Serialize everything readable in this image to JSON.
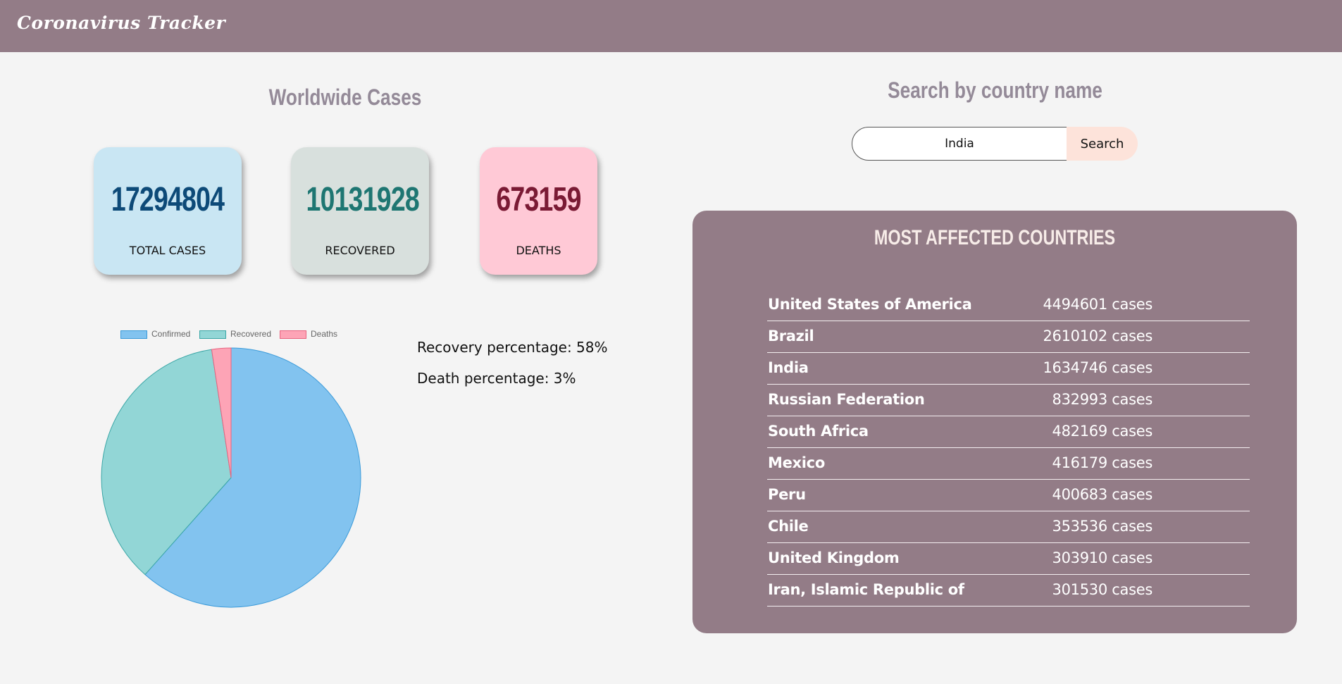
{
  "app": {
    "title": "Coronavirus Tracker"
  },
  "worldwide": {
    "title": "Worldwide Cases",
    "cards": [
      {
        "value": "17294804",
        "label": "TOTAL CASES"
      },
      {
        "value": "10131928",
        "label": "RECOVERED"
      },
      {
        "value": "673159",
        "label": "DEATHS"
      }
    ],
    "recovery_text": "Recovery percentage: 58%",
    "death_text": "Death percentage: 3%"
  },
  "search": {
    "title": "Search by country name",
    "input_value": "India",
    "button_label": "Search"
  },
  "most_affected": {
    "title": "MOST AFFECTED COUNTRIES",
    "rows": [
      {
        "country": "United States of America",
        "cases": "4494601 cases"
      },
      {
        "country": "Brazil",
        "cases": "2610102 cases"
      },
      {
        "country": "India",
        "cases": "1634746 cases"
      },
      {
        "country": "Russian Federation",
        "cases": "832993 cases"
      },
      {
        "country": "South Africa",
        "cases": "482169 cases"
      },
      {
        "country": "Mexico",
        "cases": "416179 cases"
      },
      {
        "country": "Peru",
        "cases": "400683 cases"
      },
      {
        "country": "Chile",
        "cases": "353536 cases"
      },
      {
        "country": "United Kingdom",
        "cases": "303910 cases"
      },
      {
        "country": "Iran, Islamic Republic of",
        "cases": "301530 cases"
      }
    ]
  },
  "chart_data": {
    "type": "pie",
    "categories": [
      "Confirmed",
      "Recovered",
      "Deaths"
    ],
    "values": [
      17294804,
      10131928,
      673159
    ],
    "colors": [
      "#82c3ef",
      "#92d6d6",
      "#fda4b6"
    ],
    "border_colors": [
      "#3a9ad9",
      "#3aa6a6",
      "#e8637f"
    ],
    "legend_position": "top"
  }
}
